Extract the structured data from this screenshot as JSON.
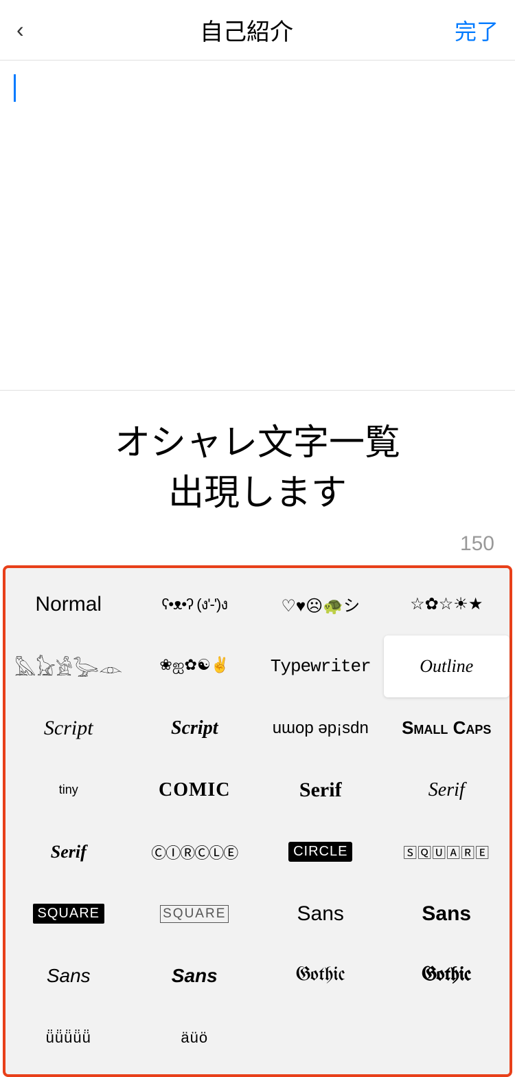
{
  "header": {
    "back_label": "<",
    "title": "自己紹介",
    "done_label": "完了"
  },
  "editor": {
    "placeholder": ""
  },
  "prompt": {
    "line1": "オシャレ文字一覧",
    "line2": "出現します"
  },
  "char_count": "150",
  "font_panel": {
    "cells": [
      {
        "id": "normal",
        "label": "Normal",
        "style": "f-normal"
      },
      {
        "id": "symbols1",
        "label": "ʕ•ᴥ•ʔ (ง'-')ง",
        "style": "f-symbols"
      },
      {
        "id": "emoji1",
        "label": "♡♥☹🐢シ",
        "style": "f-emoji"
      },
      {
        "id": "stars",
        "label": "☆✿☆☀★",
        "style": "f-stars"
      },
      {
        "id": "hieroglyph",
        "label": "𓅓𓃠𓀀𓁹",
        "style": "f-hieroglyph"
      },
      {
        "id": "swirl",
        "label": "❀ஐ✿ᕉ☯✌",
        "style": "f-swirl"
      },
      {
        "id": "typewriter",
        "label": "Typewriter",
        "style": "f-typewriter"
      },
      {
        "id": "outline",
        "label": "Outline",
        "style": "f-outline-btn",
        "outline": true
      },
      {
        "id": "script1",
        "label": "Script",
        "style": "f-script"
      },
      {
        "id": "script2",
        "label": "Script",
        "style": "f-script2"
      },
      {
        "id": "updown",
        "label": "uɯop ǝp!sdn",
        "style": "f-updown"
      },
      {
        "id": "smallcaps",
        "label": "Small Caps",
        "style": "f-smallcaps"
      },
      {
        "id": "tiny",
        "label": "tiny",
        "style": "f-tiny"
      },
      {
        "id": "comic",
        "label": "COMIC",
        "style": "f-comic"
      },
      {
        "id": "serif-bold",
        "label": "Serif",
        "style": "f-serif-bold"
      },
      {
        "id": "serif-italic",
        "label": "Serif",
        "style": "f-serif-italic"
      },
      {
        "id": "serif-bold-italic",
        "label": "Serif",
        "style": "f-serif-bold-italic"
      },
      {
        "id": "circle-outline",
        "label": "ⒸⒾⓇⒸⓁⒺ",
        "style": "f-circle-outline"
      },
      {
        "id": "circle-filled",
        "label": "🅒🅘🅡🅒🅛🅔",
        "style": "f-circle-filled"
      },
      {
        "id": "square-outline",
        "label": "🅂🅀🅄🄰🅁🄴",
        "style": "f-square-outline"
      },
      {
        "id": "square-filled",
        "label": "🆂🆀🆄🅰🆁🅴",
        "style": "f-square-filled"
      },
      {
        "id": "square-outline2",
        "label": "⌗S⌗Q⌗U⌗A⌗R⌗E",
        "style": "f-square-outline2"
      },
      {
        "id": "sans",
        "label": "Sans",
        "style": "f-sans"
      },
      {
        "id": "sans-bold",
        "label": "Sans",
        "style": "f-sans-bold"
      },
      {
        "id": "sans-italic",
        "label": "Sans",
        "style": "f-sans-italic"
      },
      {
        "id": "sans-bolditalic",
        "label": "Sans",
        "style": "f-sans-bolditalic"
      },
      {
        "id": "gothic",
        "label": "Gothic",
        "style": "f-gothic"
      },
      {
        "id": "gothic-bold",
        "label": "Gothic",
        "style": "f-gothic-bold"
      },
      {
        "id": "dot1",
        "label": "ü̈ü̈ü̈",
        "style": "f-dot"
      },
      {
        "id": "dot2",
        "label": "äüö",
        "style": "f-dot"
      }
    ]
  }
}
